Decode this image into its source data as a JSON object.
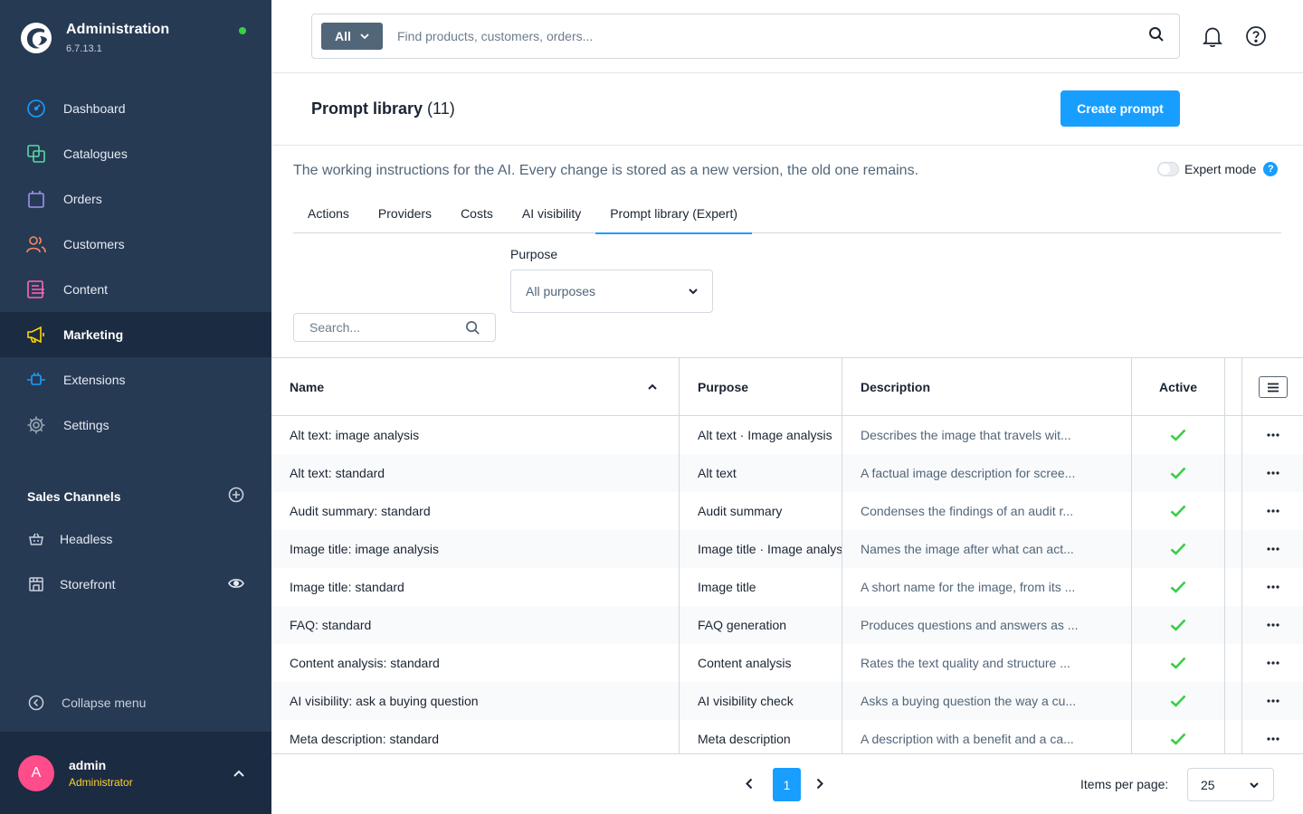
{
  "app": {
    "title": "Administration",
    "version": "6.7.13.1",
    "status_color": "#37d046"
  },
  "sidebar": {
    "items": [
      {
        "label": "Dashboard",
        "icon": "gauge-icon",
        "color": "#189eff"
      },
      {
        "label": "Catalogues",
        "icon": "catalogue-icon",
        "color": "#57d9a3"
      },
      {
        "label": "Orders",
        "icon": "shopping-bag-icon",
        "color": "#a092f0"
      },
      {
        "label": "Customers",
        "icon": "users-icon",
        "color": "#f88962"
      },
      {
        "label": "Content",
        "icon": "content-icon",
        "color": "#ff68b4"
      },
      {
        "label": "Marketing",
        "icon": "megaphone-icon",
        "color": "#ffd700",
        "active": true
      },
      {
        "label": "Extensions",
        "icon": "plug-icon",
        "color": "#189eff"
      },
      {
        "label": "Settings",
        "icon": "gear-icon",
        "color": "#9aa8b5"
      }
    ],
    "sales_channels": {
      "title": "Sales Channels",
      "items": [
        {
          "label": "Headless",
          "icon": "basket-icon"
        },
        {
          "label": "Storefront",
          "icon": "storefront-icon"
        }
      ]
    },
    "collapse_label": "Collapse menu",
    "user": {
      "initial": "A",
      "name": "admin",
      "role": "Administrator"
    }
  },
  "topbar": {
    "search_scope": "All",
    "search_placeholder": "Find products, customers, orders..."
  },
  "page": {
    "title": "Prompt library",
    "count": "(11)",
    "create_label": "Create prompt",
    "intro": "The working instructions for the AI. Every change is stored as a new version, the old one remains.",
    "expert_mode_label": "Expert mode",
    "help_glyph": "?",
    "tabs": [
      {
        "label": "Actions"
      },
      {
        "label": "Providers"
      },
      {
        "label": "Costs"
      },
      {
        "label": "AI visibility"
      },
      {
        "label": "Prompt library (Expert)",
        "active": true
      }
    ],
    "purpose_label": "Purpose",
    "purpose_value": "All purposes",
    "search_placeholder": "Search..."
  },
  "table": {
    "columns": {
      "name": "Name",
      "purpose": "Purpose",
      "description": "Description",
      "active": "Active"
    },
    "rows": [
      {
        "name": "Alt text: image analysis",
        "purpose": "Alt text · Image analysis",
        "description": "Describes the image that travels wit...",
        "active": true
      },
      {
        "name": "Alt text: standard",
        "purpose": "Alt text",
        "description": "A factual image description for scree...",
        "active": true
      },
      {
        "name": "Audit summary: standard",
        "purpose": "Audit summary",
        "description": "Condenses the findings of an audit r...",
        "active": true
      },
      {
        "name": "Image title: image analysis",
        "purpose": "Image title · Image analysis",
        "description": "Names the image after what can act...",
        "active": true
      },
      {
        "name": "Image title: standard",
        "purpose": "Image title",
        "description": "A short name for the image, from its ...",
        "active": true
      },
      {
        "name": "FAQ: standard",
        "purpose": "FAQ generation",
        "description": "Produces questions and answers as ...",
        "active": true
      },
      {
        "name": "Content analysis: standard",
        "purpose": "Content analysis",
        "description": "Rates the text quality and structure ...",
        "active": true
      },
      {
        "name": "AI visibility: ask a buying question",
        "purpose": "AI visibility check",
        "description": "Asks a buying question the way a cu...",
        "active": true
      },
      {
        "name": "Meta description: standard",
        "purpose": "Meta description",
        "description": "A description with a benefit and a ca...",
        "active": true
      }
    ]
  },
  "pagination": {
    "current_page": "1",
    "items_per_page_label": "Items per page:",
    "items_per_page": "25"
  },
  "colors": {
    "sidebar_bg": "#273a54",
    "sidebar_active_bg": "#1b2b41",
    "primary": "#189eff",
    "success": "#37d046"
  }
}
